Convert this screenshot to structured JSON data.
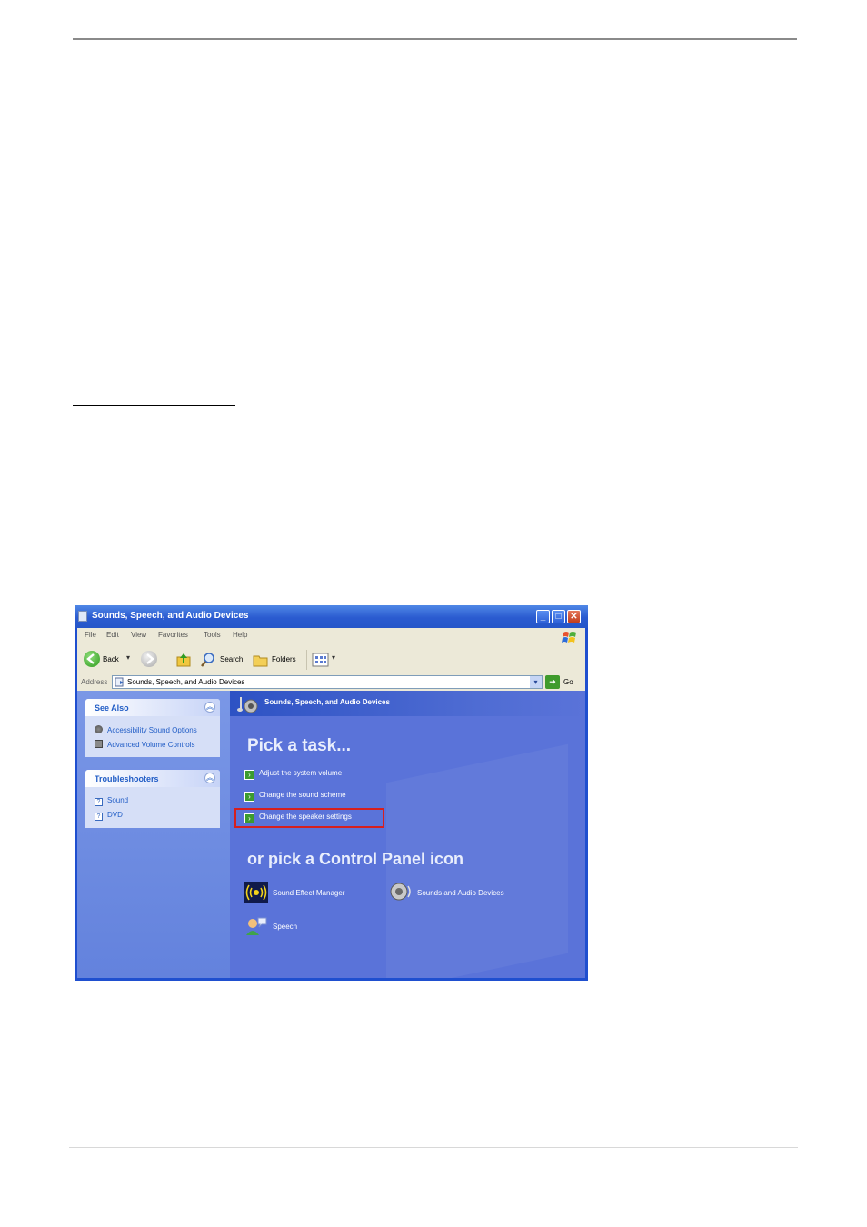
{
  "window": {
    "title": "Sounds, Speech, and Audio Devices",
    "controls": {
      "minimize": "_",
      "maximize": "□",
      "close": "✕"
    }
  },
  "menu": {
    "items": [
      "File",
      "Edit",
      "View",
      "Favorites",
      "Tools",
      "Help"
    ]
  },
  "toolbar": {
    "back_label": "Back",
    "search_label": "Search",
    "folders_label": "Folders"
  },
  "address": {
    "label": "Address",
    "value": "Sounds, Speech, and Audio Devices",
    "go_label": "Go"
  },
  "see_also": {
    "title": "See Also",
    "items": [
      "Accessibility Sound Options",
      "Advanced Volume Controls"
    ]
  },
  "troubleshooters": {
    "title": "Troubleshooters",
    "items": [
      "Sound",
      "DVD"
    ]
  },
  "main": {
    "header": "Sounds, Speech, and Audio Devices",
    "pick_task": "Pick a task...",
    "tasks": [
      "Adjust the system volume",
      "Change the sound scheme",
      "Change the speaker settings"
    ],
    "pick_icon": "or pick a Control Panel icon",
    "icons": [
      "Sound Effect Manager",
      "Sounds and Audio Devices",
      "Speech"
    ]
  },
  "colors": {
    "highlight": "#d61f1f",
    "task_pane": "#5a73d9"
  }
}
